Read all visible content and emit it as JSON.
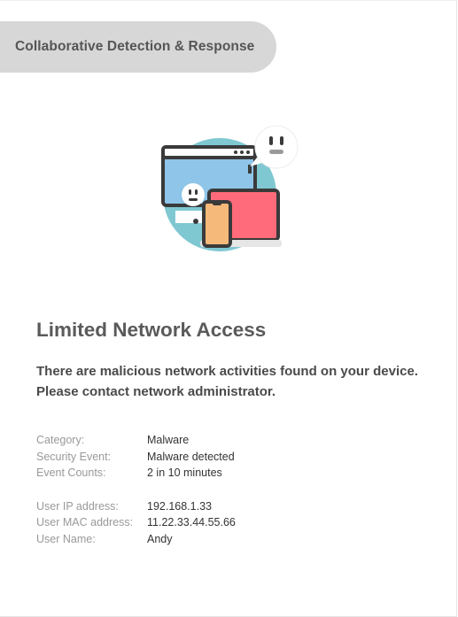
{
  "banner": {
    "title": "Collaborative Detection & Response"
  },
  "illustration": {
    "icon": "devices-alert-illustration",
    "colors": {
      "circle": "#7fc8d2",
      "monitor_screen": "#8ec5e8",
      "laptop_screen": "#ff6b7a",
      "phone_body": "#f5b97a",
      "outline": "#3a3a3a"
    }
  },
  "heading": "Limited Network Access",
  "message": {
    "line1": "There are malicious network activities found on your device.",
    "line2": "Please contact network administrator."
  },
  "event": {
    "category_label": "Category:",
    "category_value": "Malware",
    "security_event_label": "Security Event:",
    "security_event_value": "Malware detected",
    "event_counts_label": "Event Counts:",
    "event_counts_value": "2 in 10 minutes"
  },
  "user": {
    "ip_label": "User IP address:",
    "ip_value": "192.168.1.33",
    "mac_label": "User MAC address:",
    "mac_value": "11.22.33.44.55.66",
    "name_label": "User Name:",
    "name_value": "Andy"
  }
}
